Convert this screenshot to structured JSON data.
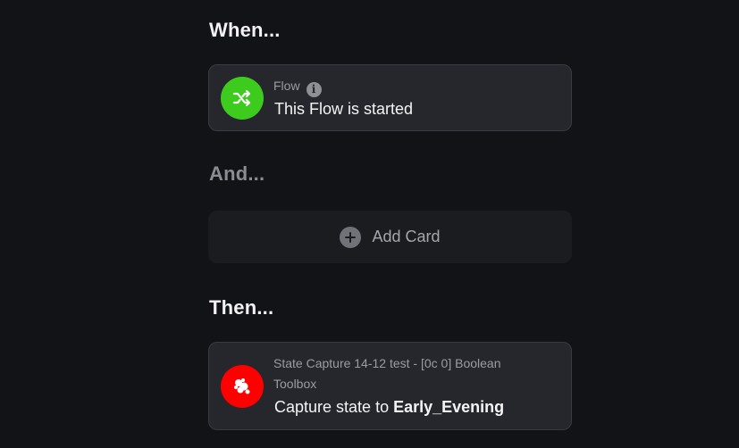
{
  "sections": {
    "when": "When...",
    "and": "And...",
    "then": "Then..."
  },
  "when_card": {
    "category": "Flow",
    "title": "This Flow is started",
    "icon": "shuffle-icon",
    "icon_color": "#3dcc1e"
  },
  "and_card": {
    "add_label": "Add Card"
  },
  "then_card": {
    "category_line1": "State Capture 14-12 test - [0c 0] Boolean",
    "category_line2": "Toolbox",
    "title_prefix": "Capture state to",
    "title_value": "Early_Evening",
    "icon": "state-capture-icon",
    "icon_color": "#ff0000"
  }
}
